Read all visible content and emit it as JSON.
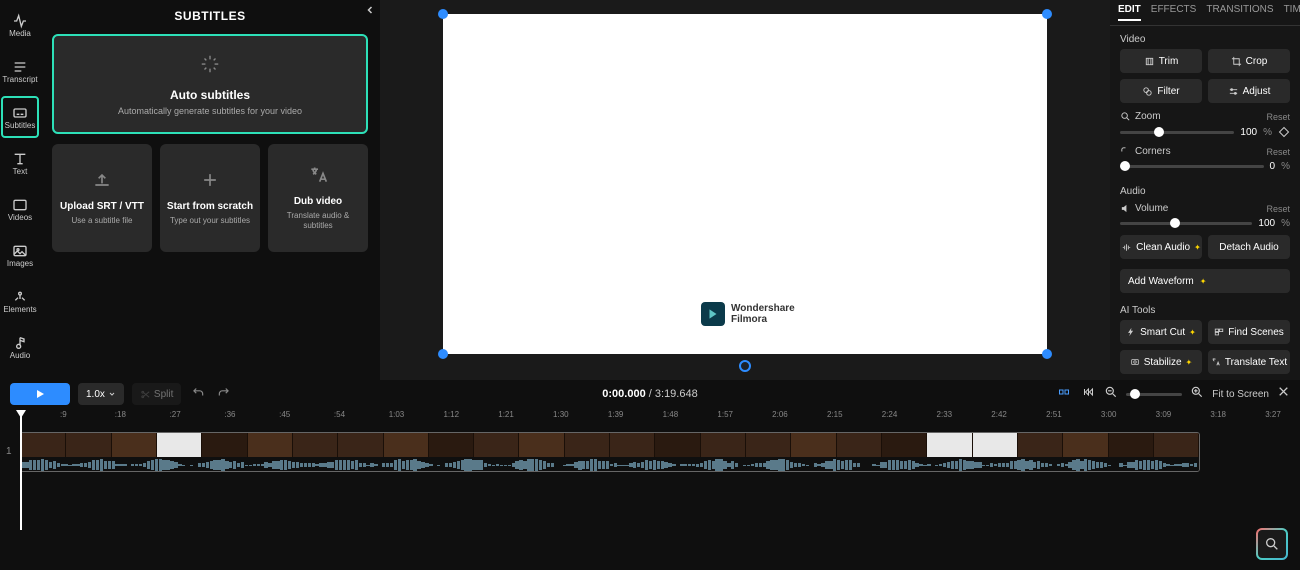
{
  "sidebar": {
    "items": [
      {
        "label": "Media"
      },
      {
        "label": "Transcript"
      },
      {
        "label": "Subtitles"
      },
      {
        "label": "Text"
      },
      {
        "label": "Videos"
      },
      {
        "label": "Images"
      },
      {
        "label": "Elements"
      },
      {
        "label": "Audio"
      }
    ]
  },
  "panel": {
    "title": "SUBTITLES",
    "auto": {
      "title": "Auto subtitles",
      "sub": "Automatically generate subtitles for your video"
    },
    "cards": [
      {
        "title": "Upload SRT / VTT",
        "sub": "Use a subtitle file"
      },
      {
        "title": "Start from scratch",
        "sub": "Type out your subtitles"
      },
      {
        "title": "Dub video",
        "sub": "Translate audio & subtitles"
      }
    ]
  },
  "preview": {
    "logo_text": "Wondershare Filmora"
  },
  "edit": {
    "tabs": [
      "EDIT",
      "EFFECTS",
      "TRANSITIONS",
      "TIMING"
    ],
    "video_label": "Video",
    "trim": "Trim",
    "crop": "Crop",
    "filter": "Filter",
    "adjust": "Adjust",
    "zoom": {
      "label": "Zoom",
      "value": "100",
      "unit": "%",
      "reset": "Reset"
    },
    "corners": {
      "label": "Corners",
      "value": "0",
      "unit": "%",
      "reset": "Reset"
    },
    "audio_label": "Audio",
    "volume": {
      "label": "Volume",
      "value": "100",
      "unit": "%",
      "reset": "Reset"
    },
    "clean": "Clean Audio",
    "detach": "Detach Audio",
    "waveform": "Add Waveform",
    "ai_label": "AI Tools",
    "smartcut": "Smart Cut",
    "findscenes": "Find Scenes",
    "stabilize": "Stabilize",
    "translate": "Translate Text"
  },
  "timeline": {
    "speed": "1.0x",
    "split": "Split",
    "current": "0:00.000",
    "duration": "3:19.648",
    "fit": "Fit to Screen",
    "track_num": "1",
    "ticks": [
      ":9",
      ":18",
      ":27",
      ":36",
      ":45",
      ":54",
      "1:03",
      "1:12",
      "1:21",
      "1:30",
      "1:39",
      "1:48",
      "1:57",
      "2:06",
      "2:15",
      "2:24",
      "2:33",
      "2:42",
      "2:51",
      "3:00",
      "3:09",
      "3:18",
      "3:27"
    ]
  }
}
